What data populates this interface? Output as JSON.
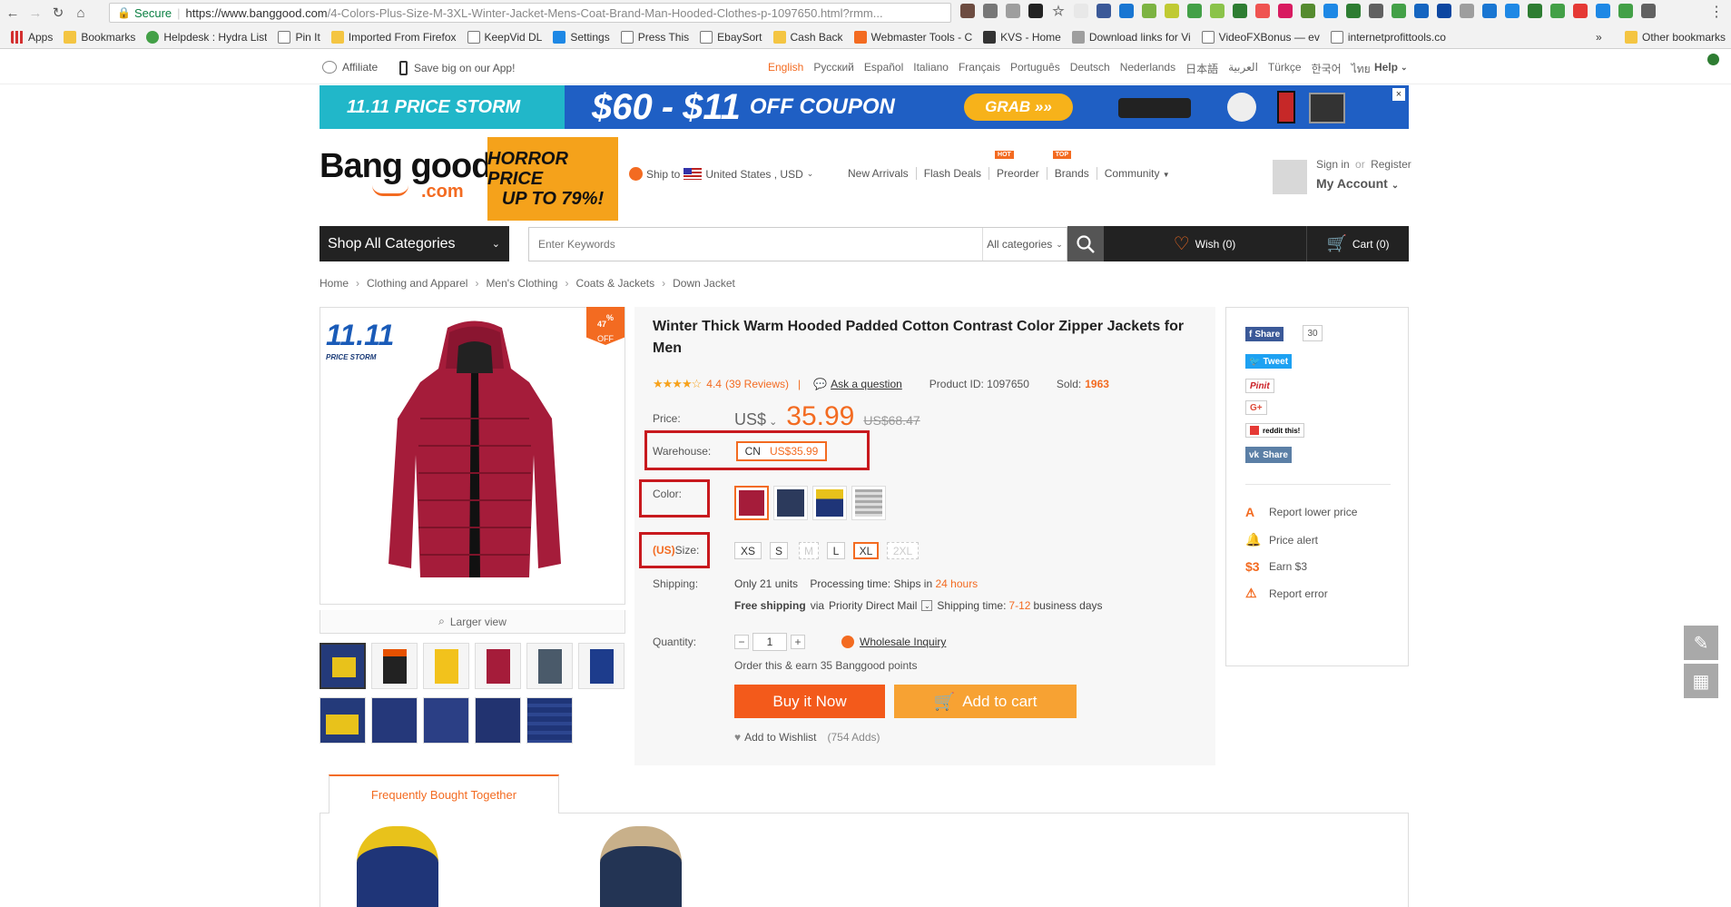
{
  "browser": {
    "secure_label": "Secure",
    "url_domain": "https://www.banggood.com",
    "url_path": "/4-Colors-Plus-Size-M-3XL-Winter-Jacket-Mens-Coat-Brand-Man-Hooded-Clothes-p-1097650.html?rmm...",
    "bookmarks": [
      "Apps",
      "Bookmarks",
      "Helpdesk : Hydra List",
      "Pin It",
      "Imported From Firefox",
      "KeepVid DL",
      "Settings",
      "Press This",
      "EbaySort",
      "Cash Back",
      "Webmaster Tools - C",
      "KVS - Home",
      "Download links for Vi",
      "VideoFXBonus — ev",
      "internetprofittools.co"
    ],
    "other_bookmarks": "Other bookmarks",
    "overflow": "»"
  },
  "topbar": {
    "affiliate": "Affiliate",
    "app": "Save big on our App!",
    "languages": [
      "English",
      "Русский",
      "Español",
      "Italiano",
      "Français",
      "Português",
      "Deutsch",
      "Nederlands",
      "日本語",
      "العربية",
      "Türkçe",
      "한국어",
      "ไทย"
    ],
    "help": "Help"
  },
  "banner": {
    "left": "11.11 PRICE STORM",
    "coupon_a": "$60",
    "coupon_dash": "-",
    "coupon_b": "$11",
    "coupon_c": "OFF COUPON",
    "grab": "GRAB »»",
    "close": "×"
  },
  "header": {
    "logo_main": "Bang good",
    "logo_sub": ".com",
    "promo_l1": "HORROR PRICE",
    "promo_l2": "UP TO 79%!",
    "ship_to": "Ship to",
    "ship_country": "United States , USD",
    "nav": [
      "New Arrivals",
      "Flash Deals",
      "Preorder",
      "Brands",
      "Community"
    ],
    "hot": "HOT",
    "top": "TOP",
    "sign_in": "Sign in",
    "or": "or",
    "register": "Register",
    "my_account": "My Account"
  },
  "searchbar": {
    "categories": "Shop All Categories",
    "placeholder": "Enter Keywords",
    "all_categories": "All categories",
    "wish": "Wish (0)",
    "cart": "Cart (0)"
  },
  "breadcrumb": [
    "Home",
    "Clothing and Apparel",
    "Men's Clothing",
    "Coats & Jackets",
    "Down Jacket"
  ],
  "product": {
    "badge_pct": "47",
    "badge_pct_sign": "%",
    "badge_off": "OFF",
    "storm_big": "11.11",
    "storm_small": "PRICE STORM",
    "larger_view": "Larger view",
    "title": "Winter Thick Warm Hooded Padded Cotton Contrast Color Zipper Jackets for Men",
    "rating_stars": "★★★★☆",
    "rating": "4.4",
    "reviews": "(39 Reviews)",
    "rating_sep": "|",
    "ask": "Ask a question",
    "product_id": "Product ID: 1097650",
    "sold_label": "Sold:",
    "sold": "1963",
    "price_label": "Price:",
    "currency": "US$",
    "price": "35.99",
    "old_price": "US$68.47",
    "warehouse_label": "Warehouse:",
    "warehouse": "CN",
    "warehouse_price": "US$35.99",
    "color_label": "Color:",
    "size_prefix": "(US)",
    "size_label": "Size:",
    "sizes": [
      "XS",
      "S",
      "M",
      "L",
      "XL",
      "2XL"
    ],
    "shipping_label": "Shipping:",
    "units": "Only 21 units",
    "processing": "Processing time:",
    "ships_in": "Ships in",
    "hours": "24 hours",
    "free_ship": "Free shipping",
    "via": "via",
    "method": "Priority Direct Mail",
    "ship_time": "Shipping time:",
    "days": "7-12",
    "business_days": "business days",
    "quantity_label": "Quantity:",
    "qty_minus": "−",
    "qty_plus": "+",
    "quantity": "1",
    "wholesale": "Wholesale Inquiry",
    "points": "Order this & earn 35 Banggood points",
    "buy_now": "Buy it Now",
    "add_cart": "Add to cart",
    "wishlist": "Add to Wishlist",
    "adds": "(754 Adds)"
  },
  "side": {
    "fb": "Share",
    "fb_count": "30",
    "tweet": "Tweet",
    "pin": "Pinit",
    "gplus": "G+",
    "reddit": "reddit this!",
    "vk": "Share",
    "report_price": "Report lower price",
    "price_alert": "Price alert",
    "earn": "Earn $3",
    "report_error": "Report error"
  },
  "bottom": {
    "tab": "Frequently Bought Together"
  }
}
